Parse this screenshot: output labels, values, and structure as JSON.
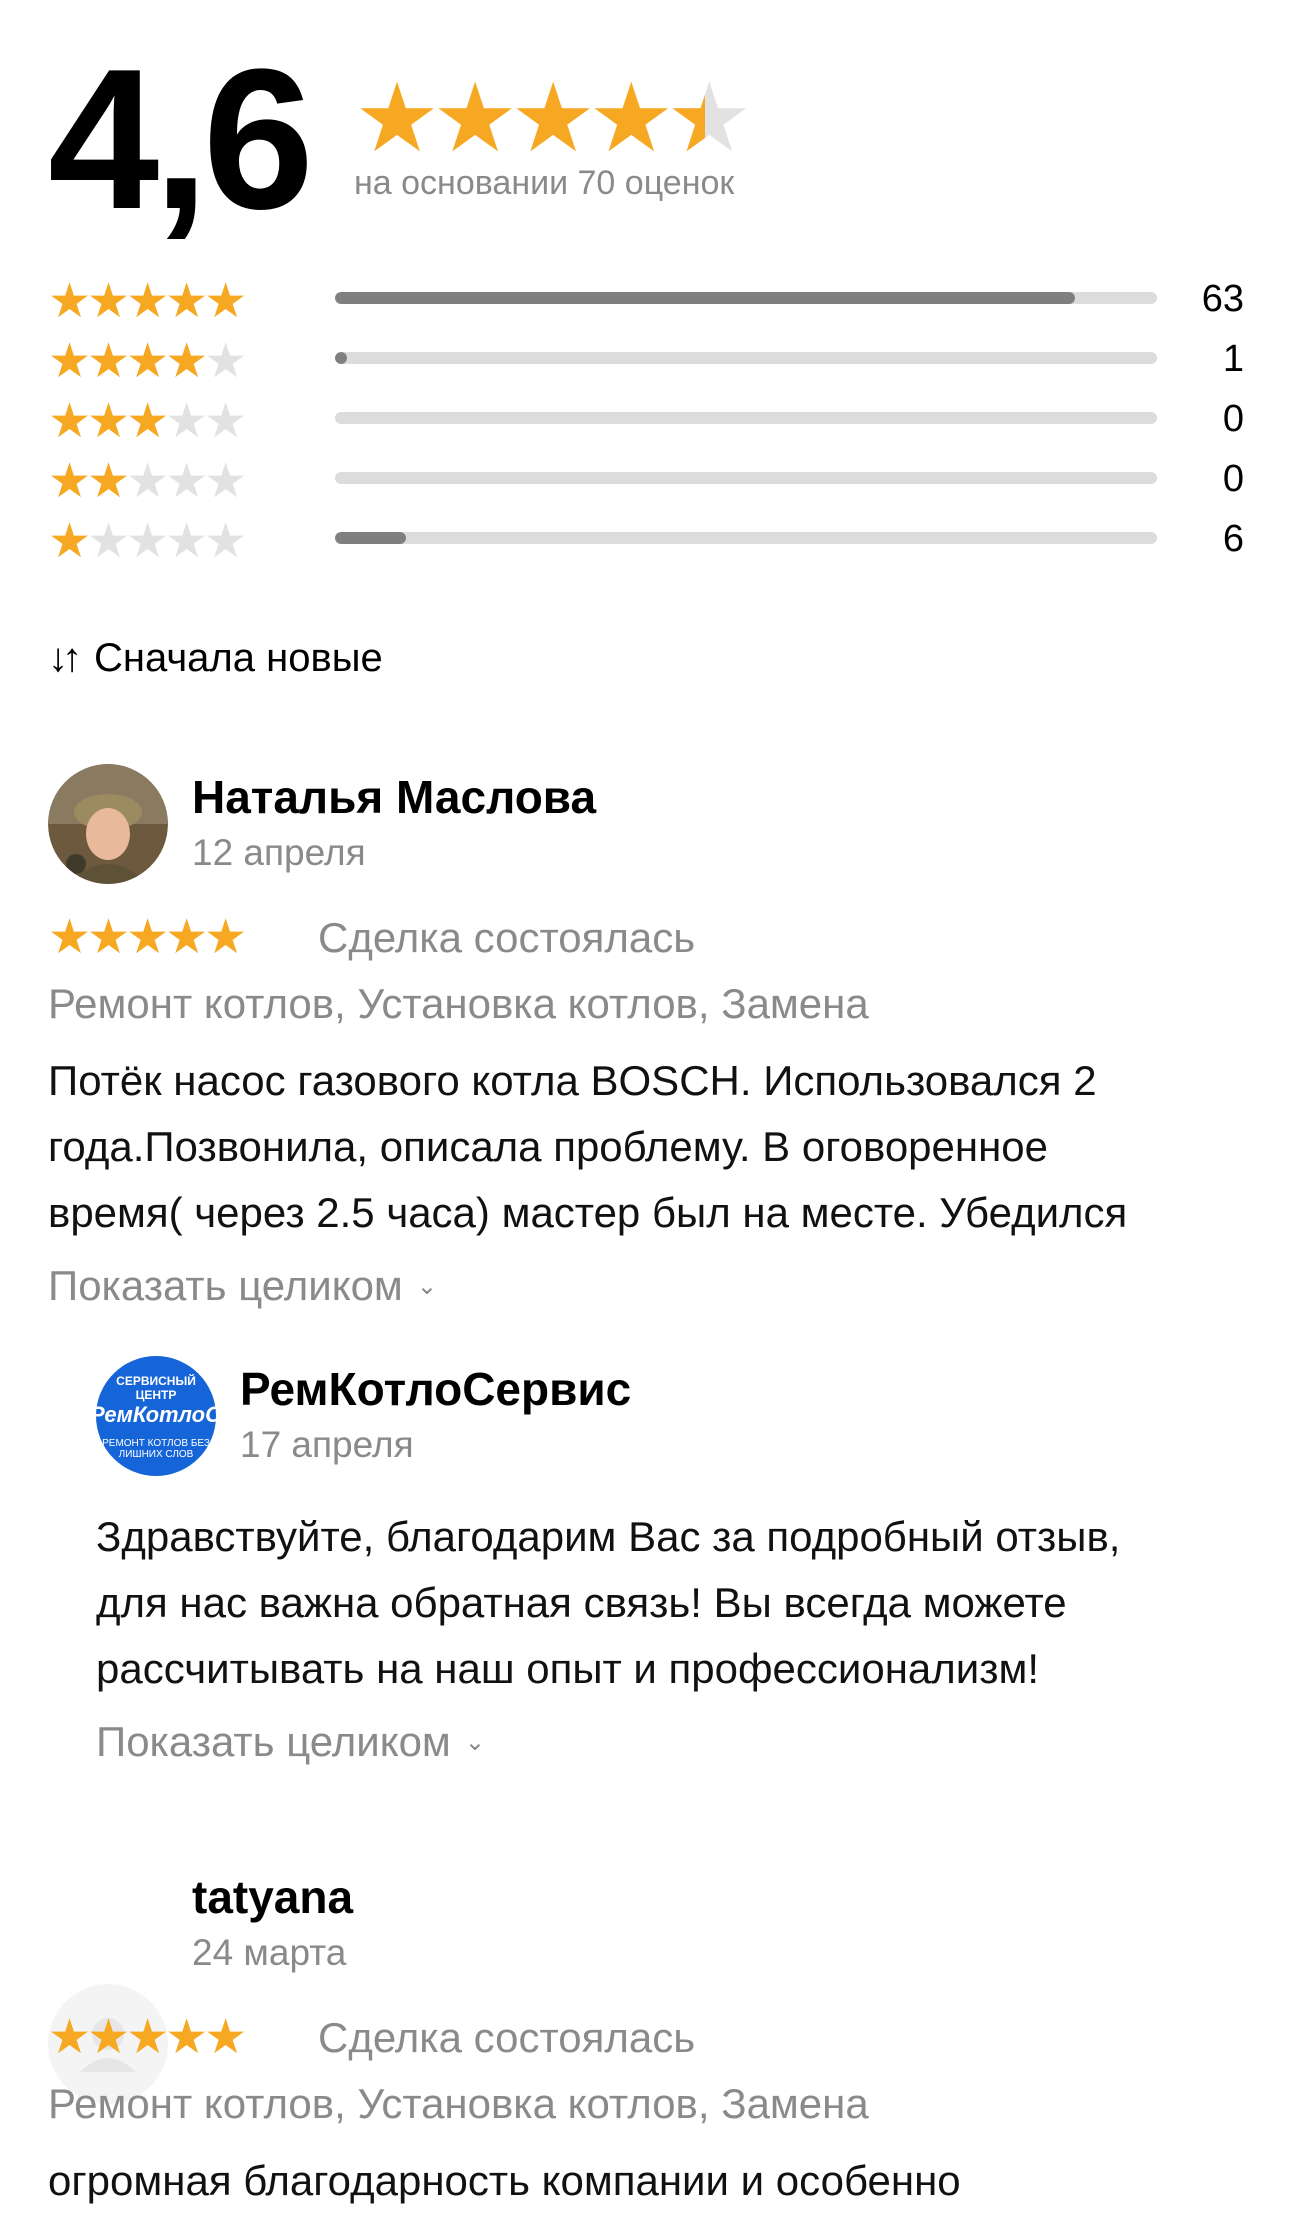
{
  "summary": {
    "rating": "4,6",
    "stars_value": 4.6,
    "based_on": "на основании 70 оценок",
    "distribution": [
      {
        "stars": 5,
        "count": "63",
        "fraction": 0.9
      },
      {
        "stars": 4,
        "count": "1",
        "fraction": 0.014
      },
      {
        "stars": 3,
        "count": "0",
        "fraction": 0
      },
      {
        "stars": 2,
        "count": "0",
        "fraction": 0
      },
      {
        "stars": 1,
        "count": "6",
        "fraction": 0.086
      }
    ]
  },
  "sort": {
    "icon": "sort-arrows-icon",
    "label": "Сначала новые"
  },
  "reviews": [
    {
      "author": "Наталья Маслова",
      "date": "12 апреля",
      "rating": 5,
      "deal_status": "Сделка состоялась",
      "services": "Ремонт котлов, Установка котлов, Замена",
      "text_lines": [
        "Потёк насос газового котла BOSCH. Использовался 2",
        "года.Позвонила, описала проблему. В оговоренное",
        "время( через 2.5 часа) мастер был на месте. Убедился"
      ],
      "show_more": "Показать целиком",
      "reply": {
        "author": "РемКотлоСервис",
        "date": "17 апреля",
        "avatar_text": [
          "СЕРВИСНЫЙ ЦЕНТР",
          "РемКотлоСерв",
          "РЕМОНТ КОТЛОВ БЕЗ ЛИШНИХ СЛОВ"
        ],
        "text_lines": [
          "Здравствуйте, благодарим Вас за подробный отзыв,",
          "для нас важна обратная связь! Вы всегда можете",
          "рассчитывать на наш опыт и профессионализм!"
        ],
        "show_more": "Показать целиком"
      }
    },
    {
      "author": "tatyana",
      "date": "24 марта",
      "rating": 5,
      "deal_status": "Сделка состоялась",
      "services": "Ремонт котлов, Установка котлов, Замена",
      "text_lines": [
        "огромная благодарность компании  и особенно"
      ]
    }
  ],
  "colors": {
    "star": "#f7a823",
    "star_empty": "#e2e2e2",
    "bar_fill": "#7f7f7f",
    "bar_track": "#dcdcdc",
    "muted_text": "#8a8a8a",
    "brand_avatar": "#1565d8"
  }
}
